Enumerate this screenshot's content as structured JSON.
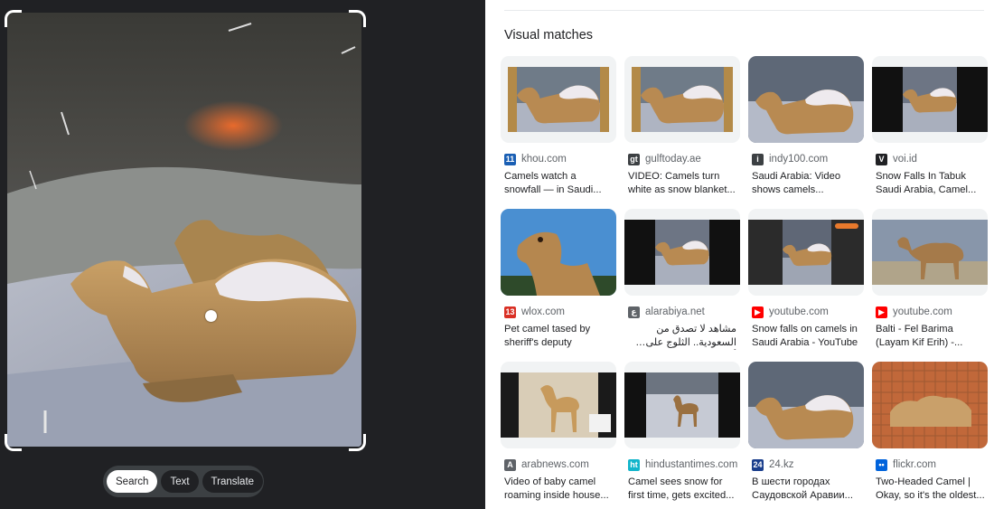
{
  "left_pane": {
    "modes": [
      {
        "label": "Search",
        "active": true
      },
      {
        "label": "Text",
        "active": false
      },
      {
        "label": "Translate",
        "active": false
      }
    ]
  },
  "results": {
    "title": "Visual matches",
    "items": [
      {
        "source": "khou.com",
        "favicon": "khou-icon",
        "favicon_text": "11",
        "favicon_color": "#1a5fb4",
        "title": "Camels watch a snowfall — in Saudi...",
        "rtl": false,
        "thumb": "camel-wide"
      },
      {
        "source": "gulftoday.ae",
        "favicon": "gulftoday-icon",
        "favicon_text": "gt",
        "favicon_color": "#3c4043",
        "title": "VIDEO: Camels turn white as snow blanket...",
        "rtl": false,
        "thumb": "camel-wide"
      },
      {
        "source": "indy100.com",
        "favicon": "indy100-icon",
        "favicon_text": "i",
        "favicon_color": "#3c4043",
        "title": "Saudi Arabia: Video shows camels...",
        "rtl": false,
        "thumb": "camel-full"
      },
      {
        "source": "voi.id",
        "favicon": "voi-icon",
        "favicon_text": "V",
        "favicon_color": "#202124",
        "title": "Snow Falls In Tabuk Saudi Arabia, Camel...",
        "rtl": false,
        "thumb": "camel-letterbox"
      },
      {
        "source": "wlox.com",
        "favicon": "wlox-icon",
        "favicon_text": "13",
        "favicon_color": "#d93025",
        "title": "Pet camel tased by sheriff's deputy",
        "rtl": false,
        "thumb": "camel-portrait"
      },
      {
        "source": "alarabiya.net",
        "favicon": "alarabiya-icon",
        "favicon_text": "ع",
        "favicon_color": "#5f6368",
        "title": "مشاهد لا تصدق من السعودية.. الثلوج على أسنام الجمال",
        "rtl": true,
        "thumb": "camel-letterbox"
      },
      {
        "source": "youtube.com",
        "favicon": "youtube-icon",
        "favicon_text": "▶",
        "favicon_color": "#ff0000",
        "title": "Snow falls on camels in Saudi Arabia - YouTube",
        "rtl": false,
        "thumb": "camel-letterbox-dark"
      },
      {
        "source": "youtube.com",
        "favicon": "youtube-icon",
        "favicon_text": "▶",
        "favicon_color": "#ff0000",
        "title": "Balti - Fel Barima (Layam Kif Erih) -...",
        "rtl": false,
        "thumb": "camel-standing"
      },
      {
        "source": "arabnews.com",
        "favicon": "arabnews-icon",
        "favicon_text": "A",
        "favicon_color": "#5f6368",
        "title": "Video of baby camel roaming inside house...",
        "rtl": false,
        "thumb": "camel-statue"
      },
      {
        "source": "hindustantimes.com",
        "favicon": "hindustantimes-icon",
        "favicon_text": "ht",
        "favicon_color": "#12b5cb",
        "title": "Camel sees snow for first time, gets excited...",
        "rtl": false,
        "thumb": "camel-snowfield"
      },
      {
        "source": "24.kz",
        "favicon": "24kz-icon",
        "favicon_text": "24",
        "favicon_color": "#1a3e8c",
        "title": "В шести городах Саудовской Аравии...",
        "rtl": false,
        "thumb": "camel-full"
      },
      {
        "source": "flickr.com",
        "favicon": "flickr-icon",
        "favicon_text": "••",
        "favicon_color": "#0063dc",
        "title": "Two-Headed Camel | Okay, so it's the oldest...",
        "rtl": false,
        "thumb": "camel-zoo"
      }
    ]
  }
}
